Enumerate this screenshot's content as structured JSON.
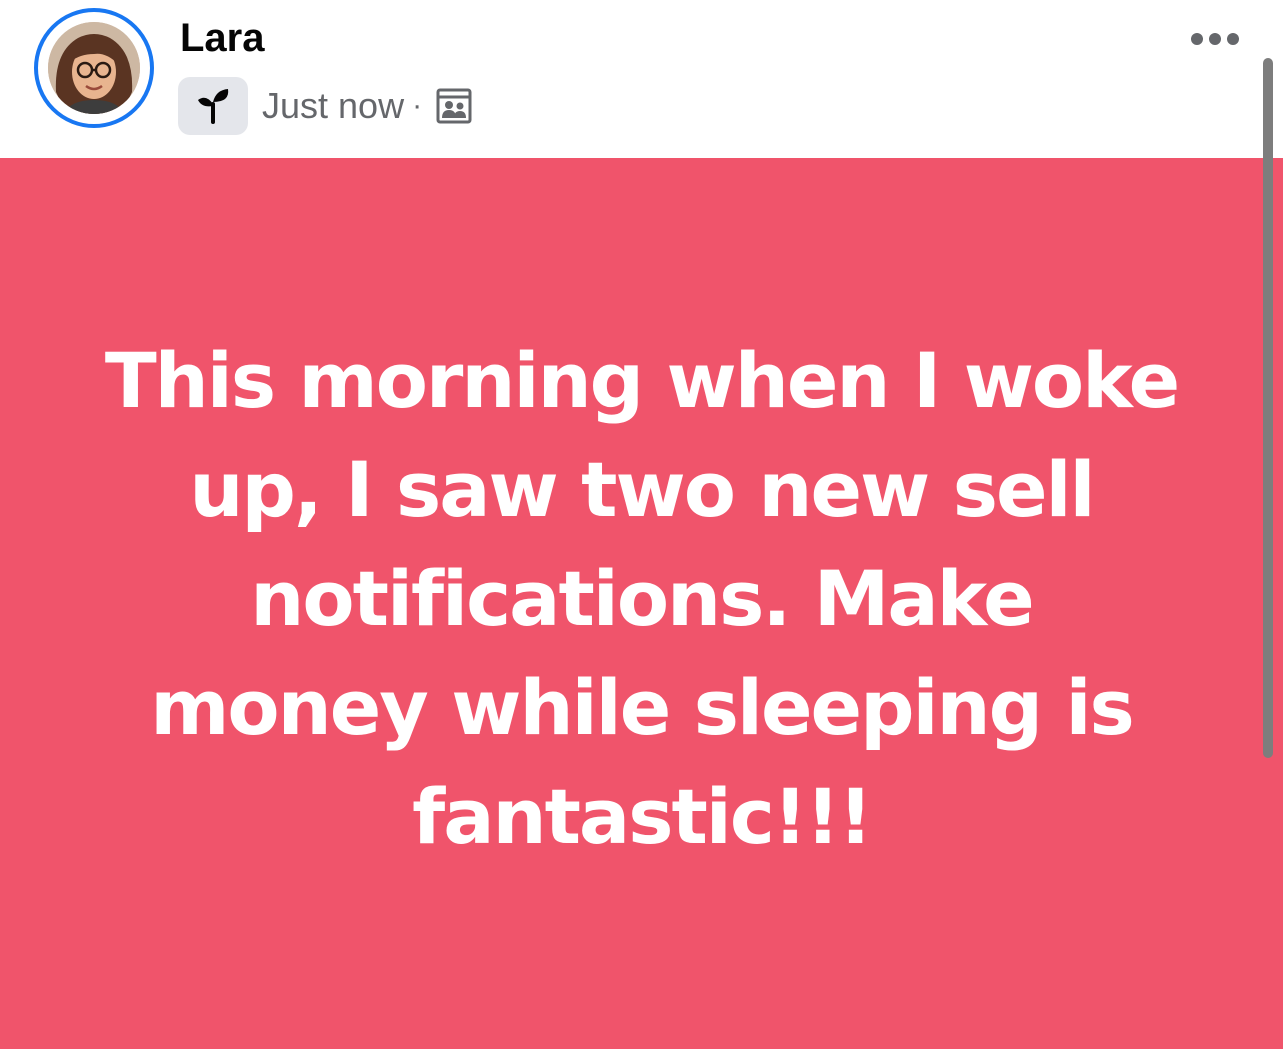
{
  "post": {
    "author": "Lara",
    "timestamp": "Just now",
    "separator": "·",
    "badge_icon": "sprout-icon",
    "audience_icon": "group-members-icon",
    "more_icon": "more-dots-icon",
    "text": "This morning when I woke up, I saw two new sell notifications. Make money while sleeping is fantastic!!!",
    "background_color": "#f0546b",
    "text_color": "#ffffff",
    "avatar_ring_color": "#1877f2"
  }
}
